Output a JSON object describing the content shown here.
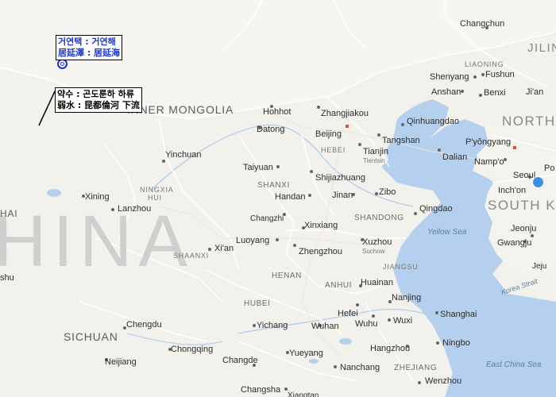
{
  "map": {
    "countries": {
      "china": "HINA",
      "inner_mongolia": "INNER MONGOLIA",
      "north_korea": "NORTH",
      "south_korea": "SOUTH KO",
      "jilin": "JILIN"
    },
    "provinces": {
      "hebei": "HEBEI",
      "shanxi": "SHANXI",
      "shaanxi": "SHAANXI",
      "henan": "HENAN",
      "shandong": "SHANDONG",
      "anhui": "ANHUI",
      "jiangsu": "JIANGSU",
      "hubei": "HUBEI",
      "zhejiang": "ZHEJIANG",
      "sichuan": "SICHUAN",
      "ningxia": "NINGXIA",
      "hui": "HUI",
      "liaoning": "LIAONING",
      "hai": "HAI"
    },
    "seas": {
      "yellow_sea": "Yellow Sea",
      "korea_strait": "Korea Strait",
      "east_china_sea": "East China Sea"
    },
    "cities": {
      "changchun": "Changchun",
      "shenyang": "Shenyang",
      "fushun": "Fushun",
      "anshan": "Anshan",
      "benxi": "Benxi",
      "jian": "Ji'an",
      "hohhot": "Hohhot",
      "zhangjiakou": "Zhangjiakou",
      "datong": "Datong",
      "beijing": "Beijing",
      "qinhuangdao": "Qinhuangdao",
      "tangshan": "Tangshan",
      "tianjin": "Tianjin",
      "tianjin_sub": "Tientsin",
      "dalian": "Dalian",
      "pyongyang": "P'yŏngyang",
      "nampo": "Namp'o",
      "seoul": "Seoul",
      "incheon": "Inch'on",
      "po": "Po",
      "yinchuan": "Yinchuan",
      "taiyuan": "Taiyuan",
      "shijiazhuang": "Shijiazhuang",
      "handan": "Handan",
      "jinan": "Jinan",
      "zibo": "Zibo",
      "qingdao": "Qingdao",
      "xining": "Xining",
      "lanzhou": "Lanzhou",
      "changzhi": "Changzhi",
      "xinxiang": "Xinxiang",
      "luoyang": "Luoyang",
      "xian": "Xi'an",
      "zhengzhou": "Zhengzhou",
      "xuzhou": "Xuzhou",
      "suchow": "Suchow",
      "jeonju": "Jeonju",
      "gwangju": "Gwangju",
      "jeju": "Jeju",
      "huainan": "Huainan",
      "nanjing": "Nanjing",
      "hefei": "Hefei",
      "wuhu": "Wuhu",
      "wuxi": "Wuxi",
      "shanghai": "Shanghai",
      "chengdu": "Chengdu",
      "yichang": "Yichang",
      "wuhan": "Wuhan",
      "chongqing": "Chongqing",
      "neijiang": "Neijiang",
      "changde": "Changde",
      "yueyang": "Yueyang",
      "hangzhou": "Hangzhou",
      "ningbo": "Ningbo",
      "nanchang": "Nanchang",
      "wenzhou": "Wenzhou",
      "changsha": "Changsha",
      "xiangtan": "Xiangtan",
      "shu": "shu"
    }
  },
  "annotations": {
    "juyan": {
      "line1": "거연택 : 거연해",
      "line2": "居延澤 : 居延海"
    },
    "ruoshui": {
      "line1": "약수 : 곤도룬하 하류",
      "line2": "弱水 : 昆都倫河 下流"
    }
  }
}
